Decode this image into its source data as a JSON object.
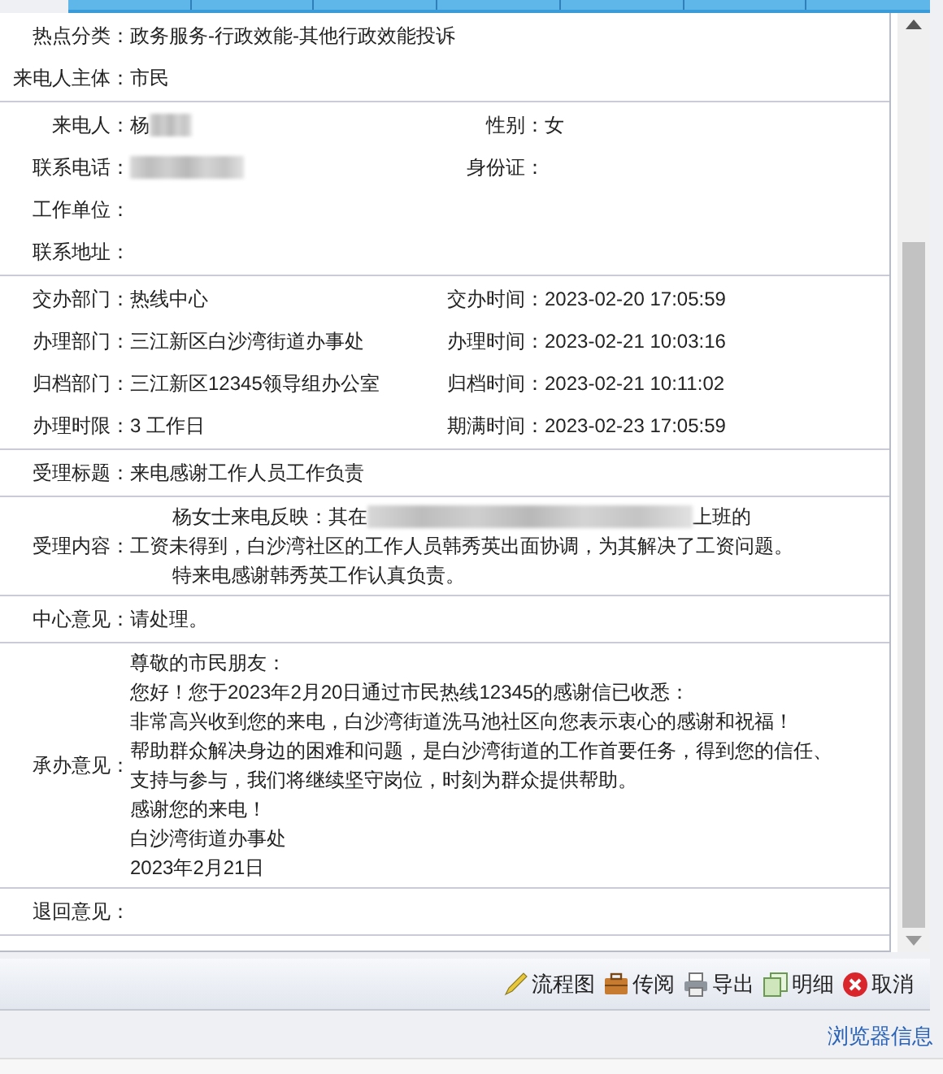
{
  "sections": [
    {
      "kind": "single",
      "fields": [
        {
          "label": "热点分类：",
          "value": "政务服务-行政效能-其他行政效能投诉"
        },
        {
          "label": "来电人主体：",
          "value": "市民"
        }
      ]
    },
    {
      "kind": "pairs",
      "rows": [
        [
          {
            "label": "来电人：",
            "value": "杨",
            "redacted": true
          },
          {
            "label": "性别：",
            "value": "女"
          }
        ],
        [
          {
            "label": "联系电话：",
            "redacted": true
          },
          {
            "label": "身份证："
          }
        ],
        [
          {
            "label": "工作单位："
          }
        ],
        [
          {
            "label": "联系地址："
          }
        ]
      ]
    },
    {
      "kind": "pairs",
      "rows": [
        [
          {
            "label": "交办部门：",
            "value": "热线中心"
          },
          {
            "label": "交办时间：",
            "value": "2023-02-20 17:05:59"
          }
        ],
        [
          {
            "label": "办理部门：",
            "value": "三江新区白沙湾街道办事处"
          },
          {
            "label": "办理时间：",
            "value": "2023-02-21 10:03:16"
          }
        ],
        [
          {
            "label": "归档部门：",
            "value": "三江新区12345领导组办公室"
          },
          {
            "label": "归档时间：",
            "value": "2023-02-21 10:11:02"
          }
        ],
        [
          {
            "label": "办理时限：",
            "value": "3 工作日"
          },
          {
            "label": "期满时间：",
            "value": "2023-02-23 17:05:59"
          }
        ]
      ]
    },
    {
      "kind": "single",
      "fields": [
        {
          "label": "受理标题：",
          "value": "来电感谢工作人员工作负责"
        }
      ]
    },
    {
      "kind": "text",
      "label": "受理内容：",
      "lines": [
        {
          "indent": true,
          "parts": [
            {
              "text": "杨女士来电反映：其在"
            },
            {
              "redacted": true
            },
            {
              "text": "上班的"
            }
          ]
        },
        {
          "indent": false,
          "parts": [
            {
              "text": "工资未得到，白沙湾社区的工作人员韩秀英出面协调，为其解决了工资问题。"
            }
          ]
        },
        {
          "indent": true,
          "parts": [
            {
              "text": "特来电感谢韩秀英工作认真负责。"
            }
          ]
        }
      ]
    },
    {
      "kind": "single",
      "fields": [
        {
          "label": "中心意见：",
          "value": "请处理。"
        }
      ]
    },
    {
      "kind": "text",
      "label": "承办意见：",
      "lines": [
        {
          "parts": [
            {
              "text": "尊敬的市民朋友："
            }
          ]
        },
        {
          "parts": [
            {
              "text": "您好！您于2023年2月20日通过市民热线12345的感谢信已收悉："
            }
          ]
        },
        {
          "parts": [
            {
              "text": "非常高兴收到您的来电，白沙湾街道洗马池社区向您表示衷心的感谢和祝福！"
            }
          ]
        },
        {
          "parts": [
            {
              "text": "帮助群众解决身边的困难和问题，是白沙湾街道的工作首要任务，得到您的信任、"
            }
          ]
        },
        {
          "parts": [
            {
              "text": "支持与参与，我们将继续坚守岗位，时刻为群众提供帮助。"
            }
          ]
        },
        {
          "parts": [
            {
              "text": "感谢您的来电！"
            }
          ]
        },
        {
          "parts": [
            {
              "text": "白沙湾街道办事处"
            }
          ]
        },
        {
          "parts": [
            {
              "text": "2023年2月21日"
            }
          ]
        }
      ]
    },
    {
      "kind": "single",
      "fields": [
        {
          "label": "退回意见："
        }
      ]
    }
  ],
  "actions": [
    {
      "kind": "pencil",
      "label": "流程图"
    },
    {
      "kind": "briefcase",
      "label": "传阅"
    },
    {
      "kind": "printer",
      "label": "导出"
    },
    {
      "kind": "pages",
      "label": "明细"
    },
    {
      "kind": "cancel",
      "label": "取消"
    }
  ],
  "browser_info": "浏览器信息"
}
